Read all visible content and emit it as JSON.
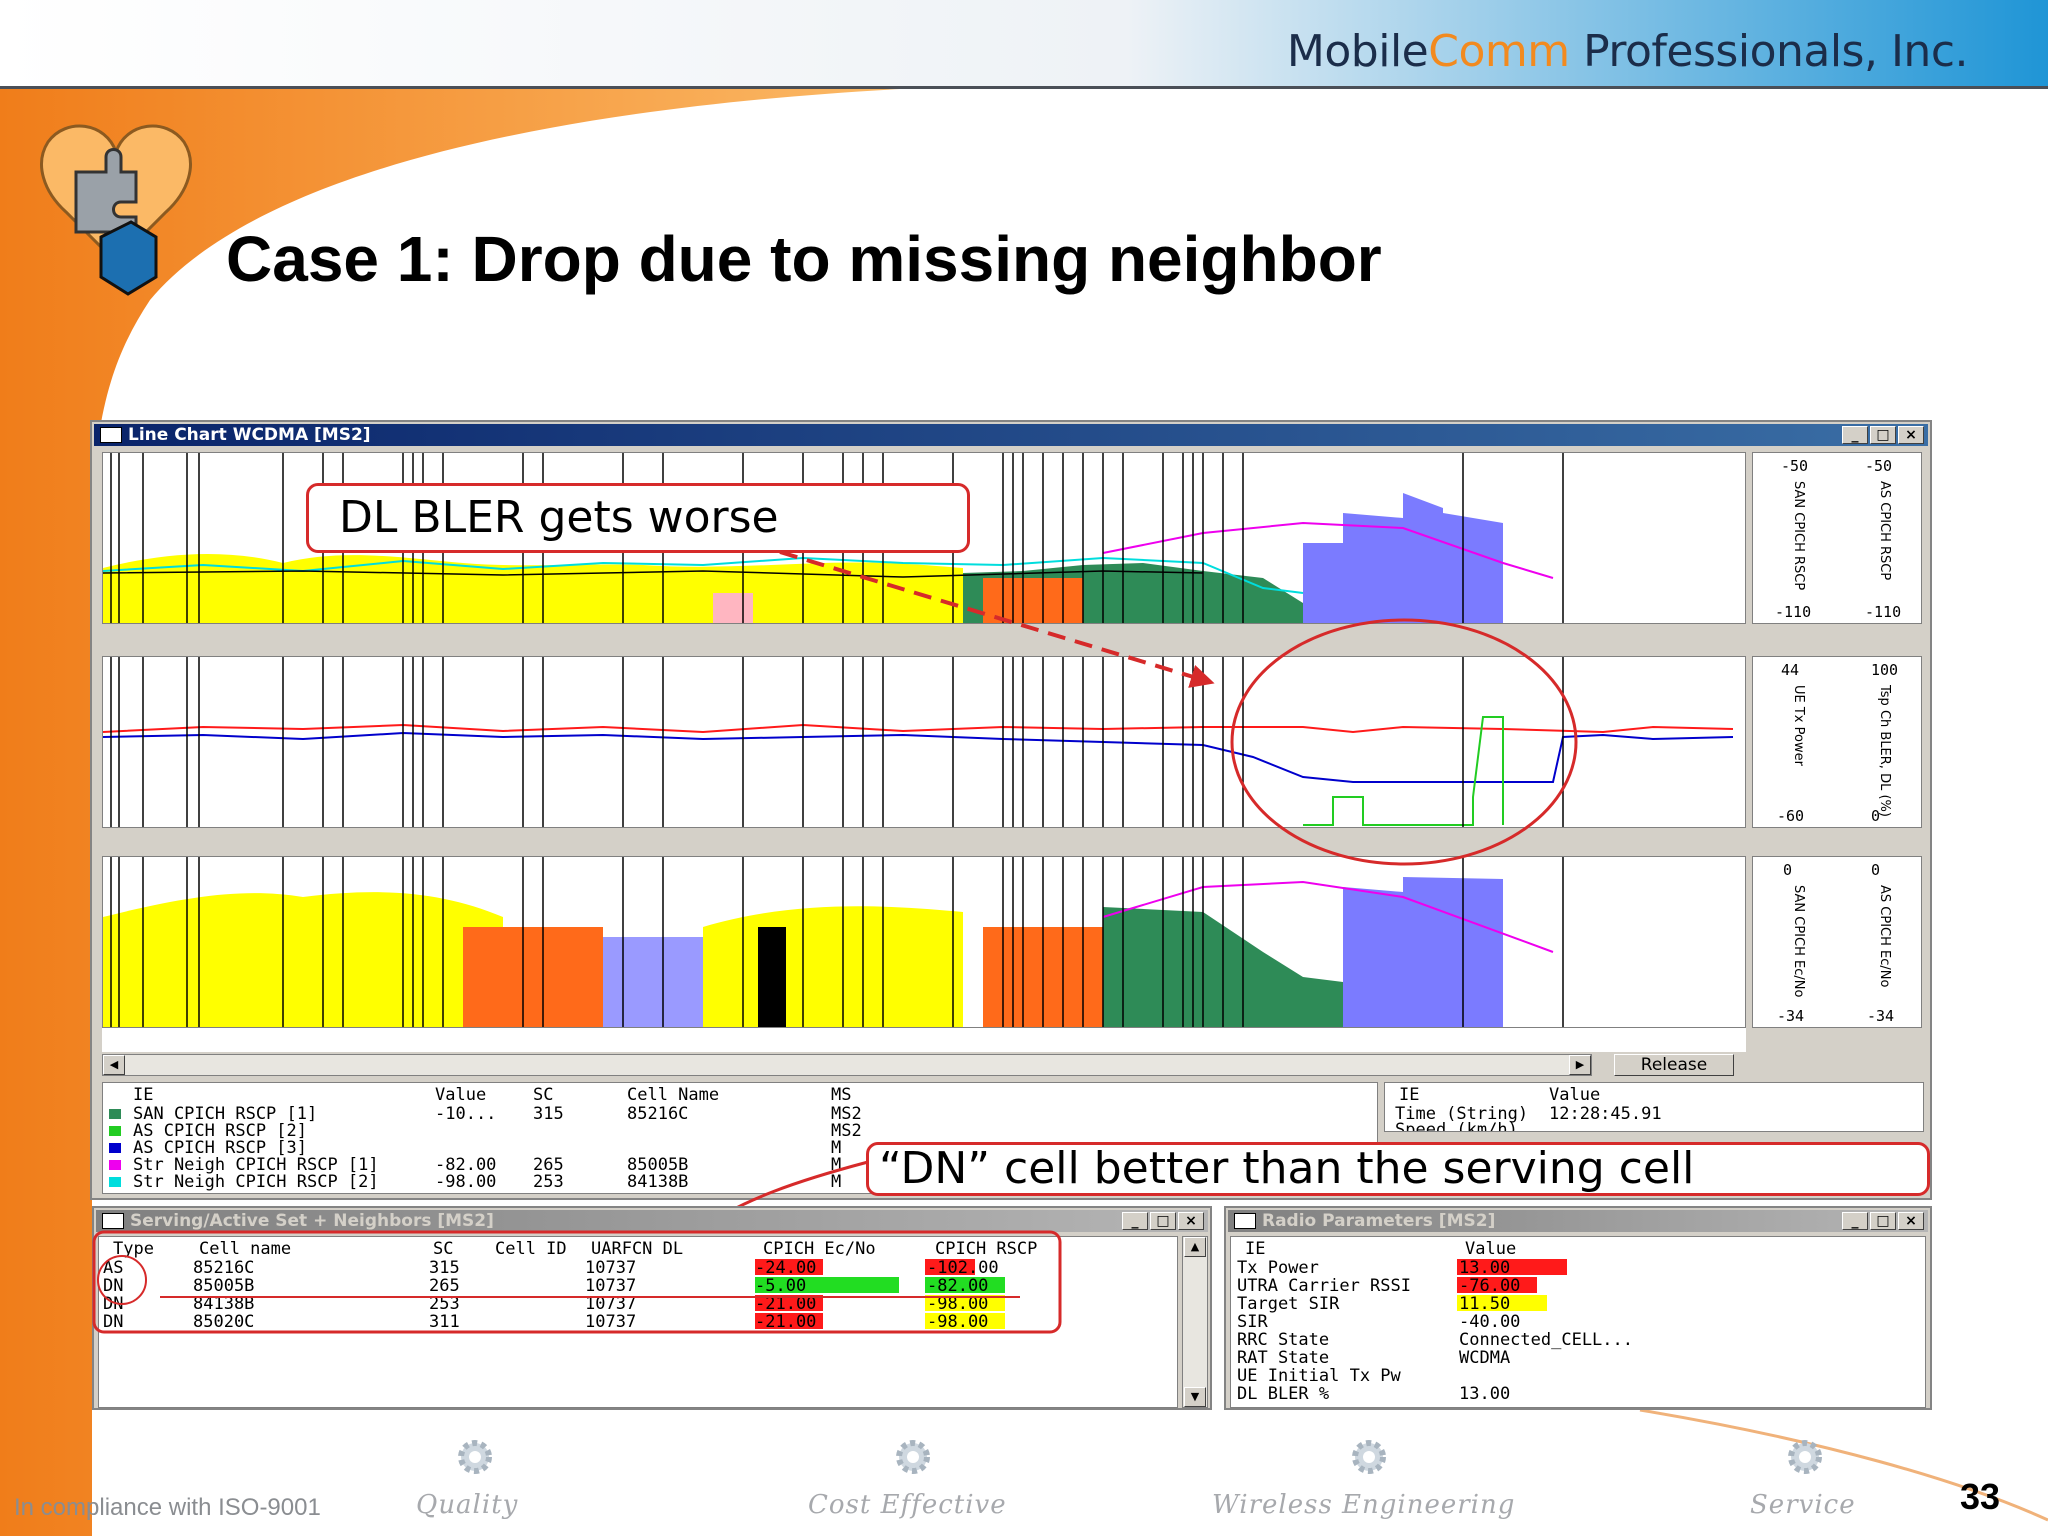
{
  "header": {
    "brand_part1": "Mobile",
    "brand_part2": "Comm",
    "brand_part3": " Professionals, Inc."
  },
  "slide": {
    "title": "Case 1: Drop due to missing neighbor",
    "page_number": "33"
  },
  "line_chart": {
    "title": "Line Chart WCDMA [MS2]",
    "panels": [
      {
        "left_axis_name": "SAN CPICH RSCP",
        "left_top": "-50",
        "left_bottom": "-110",
        "right_axis_name": "AS CPICH RSCP",
        "right_top": "-50",
        "right_bottom": "-110"
      },
      {
        "left_axis_name": "UE Tx Power",
        "left_top": "44",
        "left_bottom": "-60",
        "right_axis_name": "Tsp Ch BLER, DL (%)",
        "right_top": "100",
        "right_bottom": "0"
      },
      {
        "left_axis_name": "SAN CPICH Ec/No",
        "left_top": "0",
        "left_bottom": "-34",
        "right_axis_name": "AS CPICH Ec/No",
        "right_top": "0",
        "right_bottom": "-34"
      }
    ],
    "event_button": "Release",
    "legend_headers": [
      "IE",
      "Value",
      "SC",
      "Cell Name",
      "MS"
    ],
    "legend_rows": [
      {
        "ie": "SAN CPICH RSCP [1]",
        "value": "-10...",
        "sc": "315",
        "cell": "85216C",
        "ms": "MS2",
        "color": "#2e8b57"
      },
      {
        "ie": "AS CPICH RSCP [2]",
        "value": "",
        "sc": "",
        "cell": "",
        "ms": "MS2",
        "color": "#22cc22"
      },
      {
        "ie": "AS CPICH RSCP [3]",
        "value": "",
        "sc": "",
        "cell": "",
        "ms": "M",
        "color": "#0000cc"
      },
      {
        "ie": "Str Neigh CPICH RSCP [1]",
        "value": "-82.00",
        "sc": "265",
        "cell": "85005B",
        "ms": "M",
        "color": "#ee00ee"
      },
      {
        "ie": "Str Neigh CPICH RSCP [2]",
        "value": "-98.00",
        "sc": "253",
        "cell": "84138B",
        "ms": "M",
        "color": "#00dddd"
      }
    ],
    "info_headers": [
      "IE",
      "Value"
    ],
    "info_rows": [
      {
        "ie": "Time (String)",
        "value": "12:28:45.91"
      },
      {
        "ie": "Speed (km/h)",
        "value": ""
      }
    ]
  },
  "callouts": {
    "bler": "DL BLER gets worse",
    "dn": "“DN” cell better than the serving cell"
  },
  "serving_window": {
    "title": "Serving/Active Set + Neighbors [MS2]",
    "headers": [
      "Type",
      "Cell name",
      "SC",
      "Cell ID",
      "UARFCN DL",
      "CPICH Ec/No",
      "CPICH RSCP"
    ],
    "rows": [
      {
        "type": "AS",
        "cell": "85216C",
        "sc": "315",
        "cellid": "",
        "uarfcn": "10737",
        "ecno": "-24.00",
        "rscp": "-102.00",
        "ecno_color": "#ff1a1a",
        "rscp_color": "#ff1a1a"
      },
      {
        "type": "DN",
        "cell": "85005B",
        "sc": "265",
        "cellid": "",
        "uarfcn": "10737",
        "ecno": "-5.00",
        "rscp": "-82.00",
        "ecno_color": "#22dd22",
        "rscp_color": "#22dd22"
      },
      {
        "type": "DN",
        "cell": "84138B",
        "sc": "253",
        "cellid": "",
        "uarfcn": "10737",
        "ecno": "-21.00",
        "rscp": "-98.00",
        "ecno_color": "#ff1a1a",
        "rscp_color": "#ffff00"
      },
      {
        "type": "DN",
        "cell": "85020C",
        "sc": "311",
        "cellid": "",
        "uarfcn": "10737",
        "ecno": "-21.00",
        "rscp": "-98.00",
        "ecno_color": "#ff1a1a",
        "rscp_color": "#ffff00"
      }
    ]
  },
  "radio_window": {
    "title": "Radio Parameters [MS2]",
    "headers": [
      "IE",
      "Value"
    ],
    "rows": [
      {
        "ie": "Tx Power",
        "value": "13.00",
        "color": "#ff1a1a",
        "fill": 0.55
      },
      {
        "ie": "UTRA Carrier RSSI",
        "value": "-76.00",
        "color": "#ff1a1a",
        "fill": 0.4
      },
      {
        "ie": "Target SIR",
        "value": "11.50",
        "color": "#ffff00",
        "fill": 0.45
      },
      {
        "ie": "SIR",
        "value": "-40.00",
        "color": "",
        "fill": 0
      },
      {
        "ie": "RRC State",
        "value": "Connected_CELL...",
        "color": "",
        "fill": 0
      },
      {
        "ie": "RAT State",
        "value": "WCDMA",
        "color": "",
        "fill": 0
      },
      {
        "ie": "UE Initial Tx Pw",
        "value": "",
        "color": "",
        "fill": 0
      },
      {
        "ie": "DL BLER %",
        "value": "13.00",
        "color": "",
        "fill": 0
      }
    ]
  },
  "footer": {
    "iso": "In compliance with ISO-9001",
    "items": [
      "Quality",
      "Cost Effective",
      "Wireless Engineering",
      "Service"
    ]
  },
  "colors": {
    "accent_orange": "#f28a1f",
    "brand_navy": "#1b2d4a",
    "callout_red": "#d62a2a"
  }
}
